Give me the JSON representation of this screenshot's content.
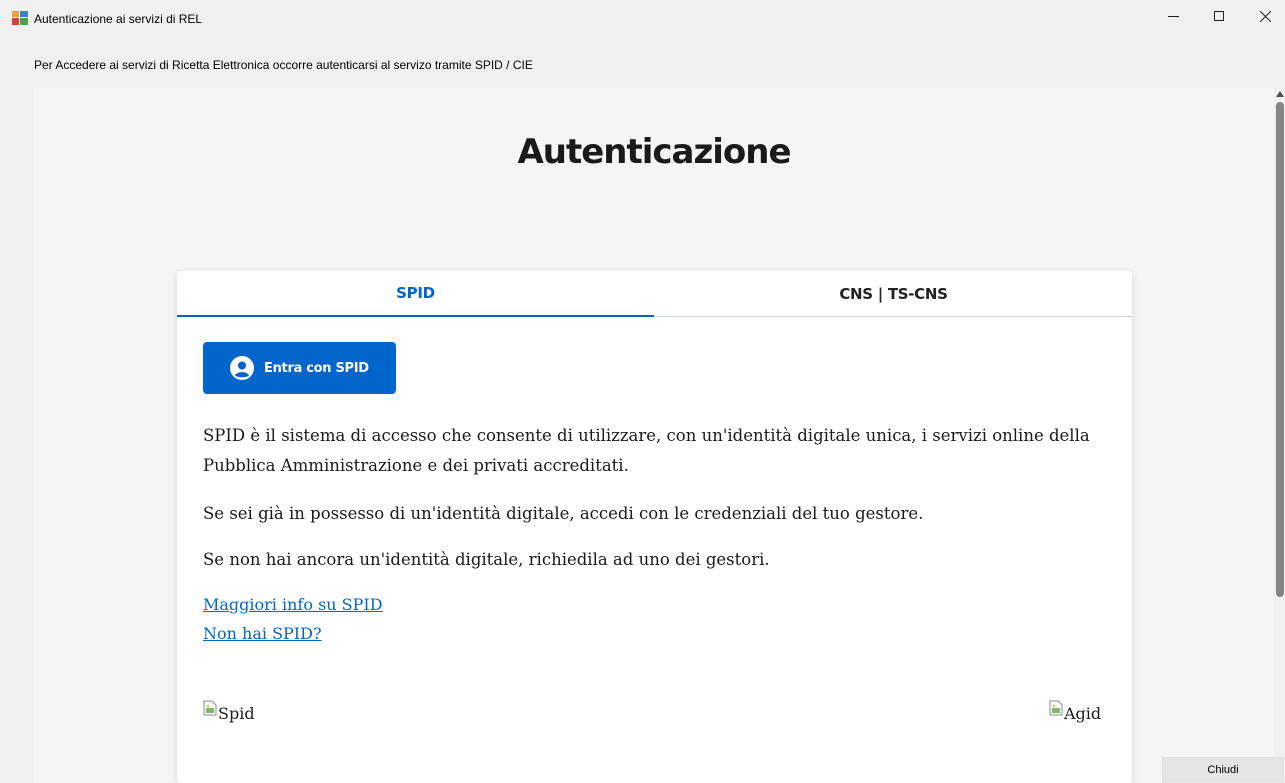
{
  "window": {
    "title": "Autenticazione ai servizi di REL",
    "minimize_glyph": "—",
    "maximize_glyph": "☐",
    "close_glyph": "✕"
  },
  "info_label": "Per Accedere ai servizi di Ricetta Elettronica occorre autenticarsi al servizo tramite SPID / CIE",
  "page": {
    "title": "Autenticazione",
    "tabs": [
      {
        "label": "SPID",
        "active": true
      },
      {
        "label": "CNS | TS-CNS",
        "active": false
      }
    ],
    "spid_button_label": "Entra con SPID",
    "paragraphs": [
      "SPID è il sistema di accesso che consente di utilizzare, con un'identità digitale unica, i servizi online della Pubblica Amministrazione e dei privati accreditati.",
      "Se sei già in possesso di un'identità digitale, accedi con le credenziali del tuo gestore.",
      "Se non hai ancora un'identità digitale, richiedila ad uno dei gestori."
    ],
    "links": [
      "Maggiori info su SPID",
      "Non hai SPID?"
    ],
    "images": [
      {
        "alt": "Spid"
      },
      {
        "alt": "Agid"
      }
    ]
  },
  "footer": {
    "close_button_label": "Chiudi"
  },
  "colors": {
    "accent": "#0066cc",
    "page_background": "#f5f5f5",
    "window_background": "#f0f0f0"
  },
  "icons": {
    "app": "app-window-icon",
    "user": "user-circle-icon",
    "broken_image": "broken-image-icon"
  }
}
